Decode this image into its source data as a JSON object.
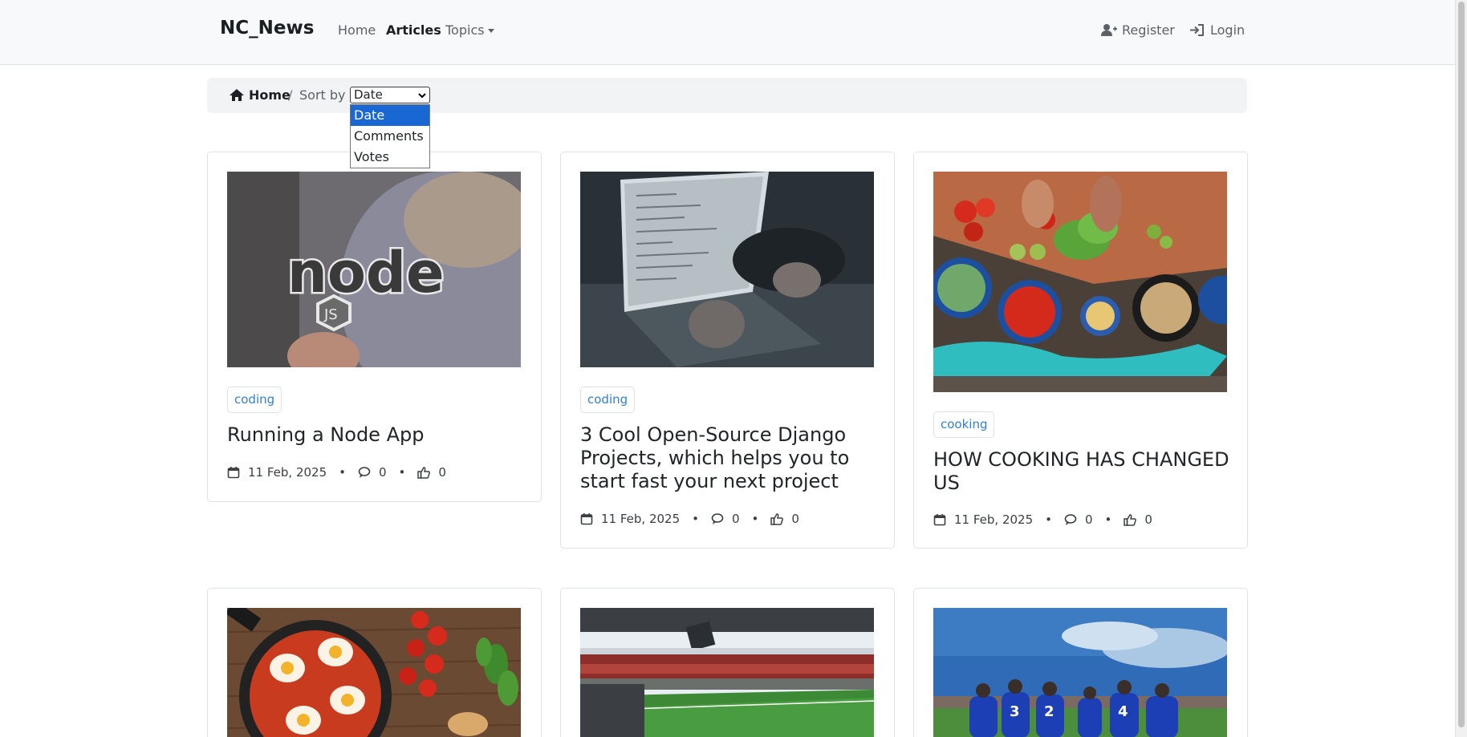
{
  "nav": {
    "brand": "NC_News",
    "links": [
      "Home",
      "Articles",
      "Topics"
    ],
    "register": "Register",
    "login": "Login"
  },
  "breadcrumb": {
    "home": "Home",
    "separator": "/",
    "sort_label": "Sort by",
    "sort_value": "Date",
    "sort_options": [
      "Date",
      "Comments",
      "Votes"
    ]
  },
  "articles": [
    {
      "topic": "coding",
      "title": "Running a Node App",
      "date": "11 Feb, 2025",
      "comments": "0",
      "votes": "0",
      "image": "node-js-sticker-photo"
    },
    {
      "topic": "coding",
      "title": "3 Cool Open-Source Django Projects, which helps you to start fast your next project",
      "date": "11 Feb, 2025",
      "comments": "0",
      "votes": "0",
      "image": "laptop-typing-photo"
    },
    {
      "topic": "cooking",
      "title": "HOW COOKING HAS CHANGED US",
      "date": "11 Feb, 2025",
      "comments": "0",
      "votes": "0",
      "image": "vegetables-cutting-board-photo"
    },
    {
      "image": "shakshuka-pan-photo"
    },
    {
      "image": "football-stadium-photo"
    },
    {
      "image": "football-team-huddle-photo"
    }
  ],
  "colors": {
    "accent": "#2f7fd4",
    "navbar_bg": "#f8f9fa",
    "dropdown_selected": "#1967d2"
  }
}
